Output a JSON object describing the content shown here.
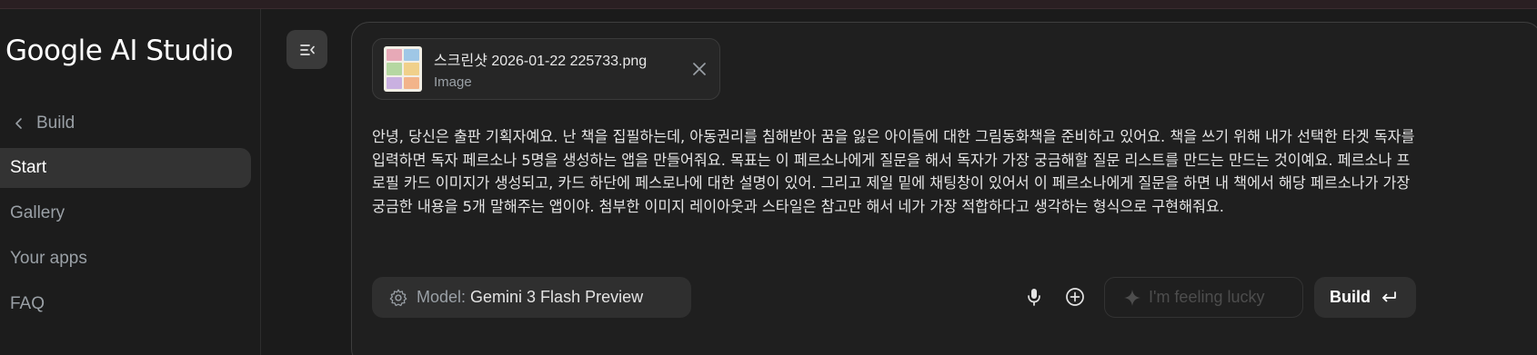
{
  "sidebar": {
    "brand": "Google AI Studio",
    "back_label": "Build",
    "items": [
      {
        "label": "Start",
        "active": true
      },
      {
        "label": "Gallery",
        "active": false
      },
      {
        "label": "Your apps",
        "active": false
      },
      {
        "label": "FAQ",
        "active": false
      }
    ]
  },
  "attachment": {
    "file_name": "스크린샷 2026-01-22 225733.png",
    "file_type": "Image",
    "thumbnail_icon": "image-thumbnail"
  },
  "prompt": {
    "text": "안녕, 당신은 출판 기획자예요. 난 책을 집필하는데, 아동권리를 침해받아 꿈을 잃은 아이들에 대한 그림동화책을 준비하고 있어요. 책을 쓰기 위해 내가 선택한 타겟 독자를 입력하면 독자 페르소나 5명을 생성하는 앱을 만들어줘요. 목표는 이 페르소나에게 질문을 해서 독자가 가장 궁금해할 질문 리스트를 만드는 만드는 것이예요. 페르소나 프로필 카드 이미지가 생성되고, 카드 하단에 페스로나에 대한 설명이 있어. 그리고 제일 밑에 채팅창이 있어서 이 페르소나에게 질문을 하면 내 책에서 해당 페르소나가 가장 궁금한 내용을 5개 말해주는 앱이야. 첨부한 이미지 레이아웃과 스타일은 참고만 해서 네가 가장 적합하다고 생각하는 형식으로 구현해줘요."
  },
  "toolbar": {
    "model_label": "Model:",
    "model_value": "Gemini 3 Flash Preview",
    "lucky_label": "I'm feeling lucky",
    "build_label": "Build"
  },
  "colors": {
    "background": "#1b1b1b",
    "panel": "#1f1f1f",
    "chip": "#2f2f2f",
    "active_nav": "#333333",
    "muted_text": "#9aa0a6"
  }
}
